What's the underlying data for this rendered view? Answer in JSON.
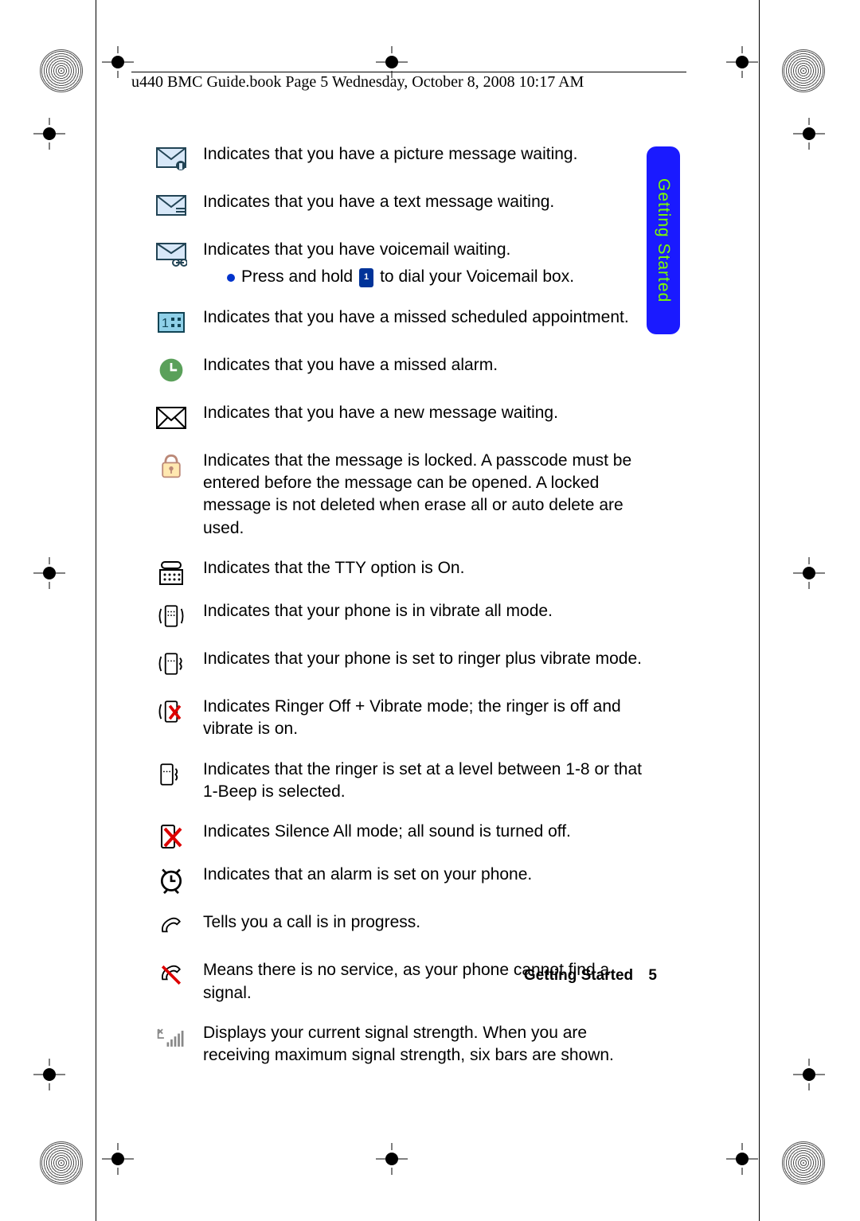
{
  "header": "u440 BMC Guide.book  Page 5  Wednesday, October 8, 2008  10:17 AM",
  "tab_label": "Getting Started",
  "footer": {
    "section": "Getting Started",
    "page": "5"
  },
  "voicemail_key": "1",
  "rows": [
    {
      "icon": "picture-message-icon",
      "text": "Indicates that you have a picture message waiting."
    },
    {
      "icon": "text-message-icon",
      "text": "Indicates that you have a text message waiting."
    },
    {
      "icon": "voicemail-icon",
      "text": "Indicates that you have voicemail waiting.",
      "bullet_pre": "Press and hold",
      "bullet_post": "to dial your Voicemail box."
    },
    {
      "icon": "appointment-icon",
      "text": "Indicates that you have a missed scheduled appointment."
    },
    {
      "icon": "missed-alarm-icon",
      "text": "Indicates that you have a missed alarm."
    },
    {
      "icon": "new-message-icon",
      "text": "Indicates that you have a new message waiting."
    },
    {
      "icon": "locked-message-icon",
      "text": "Indicates that the message is locked. A passcode must be entered before the message can be opened. A locked message is not deleted when erase all or auto delete are used."
    },
    {
      "icon": "tty-icon",
      "text": "Indicates that the TTY option is On."
    },
    {
      "icon": "vibrate-all-icon",
      "text": "Indicates that your phone is in vibrate all mode."
    },
    {
      "icon": "ringer-vibrate-icon",
      "text": "Indicates that your phone is set to ringer plus vibrate mode."
    },
    {
      "icon": "ringer-off-vibrate-icon",
      "text": "Indicates Ringer Off + Vibrate mode; the ringer is off and vibrate is on."
    },
    {
      "icon": "ringer-level-icon",
      "text": "Indicates that the ringer is set at a level between 1-8 or that 1-Beep is selected."
    },
    {
      "icon": "silence-all-icon",
      "text": "Indicates Silence All mode; all sound is turned off."
    },
    {
      "icon": "alarm-set-icon",
      "text": "Indicates that an alarm is set on your phone."
    },
    {
      "icon": "call-in-progress-icon",
      "text": "Tells you a call is in progress."
    },
    {
      "icon": "no-service-icon",
      "text": "Means there is no service, as your phone cannot find a signal."
    },
    {
      "icon": "signal-strength-icon",
      "text": "Displays your current signal strength. When you are receiving maximum signal strength, six bars are shown."
    }
  ]
}
